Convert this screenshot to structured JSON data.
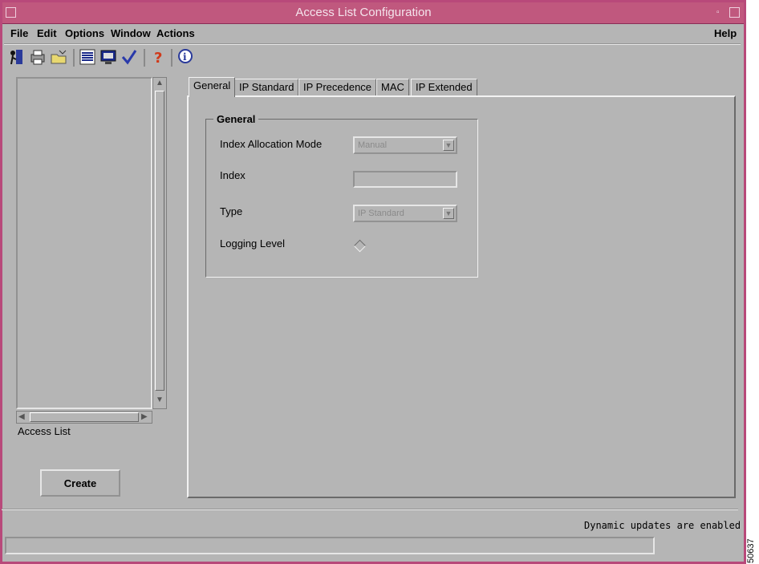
{
  "window": {
    "title": "Access List Configuration"
  },
  "menubar": {
    "items": [
      {
        "label": "File"
      },
      {
        "label": "Edit"
      },
      {
        "label": "Options"
      },
      {
        "label": "Window"
      },
      {
        "label": "Actions"
      }
    ],
    "help": "Help"
  },
  "toolbar": {
    "icons": [
      "exit-icon",
      "print-icon",
      "open-folder-icon",
      "list-icon",
      "monitor-icon",
      "checkmark-icon",
      "help-question-icon",
      "info-icon"
    ]
  },
  "left": {
    "list_label": "Access List",
    "create_button": "Create"
  },
  "tabs": [
    {
      "label": "General",
      "active": true
    },
    {
      "label": "IP Standard"
    },
    {
      "label": "IP Precedence"
    },
    {
      "label": "MAC"
    },
    {
      "label": "IP Extended"
    }
  ],
  "general": {
    "group_title": "General",
    "index_allocation_mode_label": "Index Allocation Mode",
    "index_allocation_mode_value": "Manual",
    "index_label": "Index",
    "index_value": "",
    "type_label": "Type",
    "type_value": "IP Standard",
    "logging_level_label": "Logging Level"
  },
  "status": {
    "message": "Dynamic updates are enabled",
    "figure_number": "50637"
  }
}
